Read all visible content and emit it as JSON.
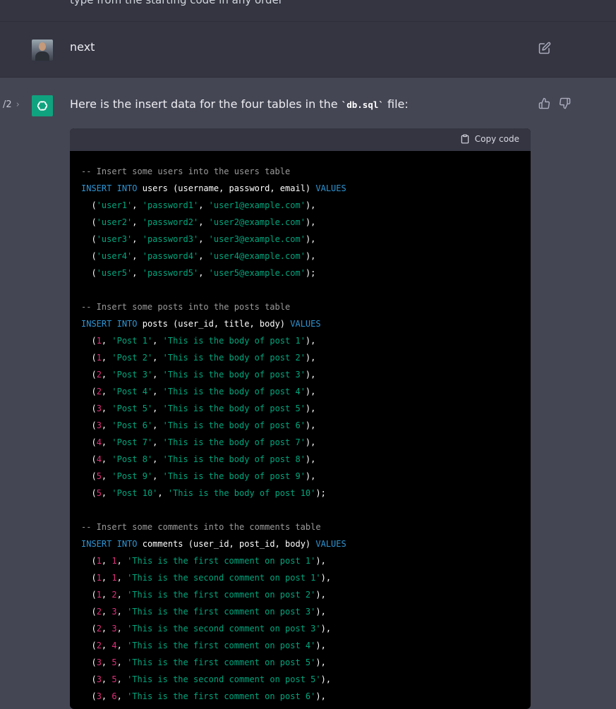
{
  "top": {
    "cut_text": "type from the starting code in any order"
  },
  "user_message": {
    "text": "next"
  },
  "assistant": {
    "pager": "/2",
    "intro_before": "Here is the insert data for the four tables in the ",
    "intro_code": "`db.sql`",
    "intro_after": " file:",
    "copy_label": "Copy code"
  },
  "code_lines": [
    [
      [
        "cm",
        "-- Insert some users into the users table"
      ]
    ],
    [
      [
        "kw",
        "INSERT"
      ],
      [
        "p",
        " "
      ],
      [
        "kw",
        "INTO"
      ],
      [
        "p",
        " users (username, password, email) "
      ],
      [
        "kw",
        "VALUES"
      ]
    ],
    [
      [
        "p",
        "  ("
      ],
      [
        "st",
        "'user1'"
      ],
      [
        "p",
        ", "
      ],
      [
        "st",
        "'password1'"
      ],
      [
        "p",
        ", "
      ],
      [
        "st",
        "'user1@example.com'"
      ],
      [
        "p",
        "),"
      ]
    ],
    [
      [
        "p",
        "  ("
      ],
      [
        "st",
        "'user2'"
      ],
      [
        "p",
        ", "
      ],
      [
        "st",
        "'password2'"
      ],
      [
        "p",
        ", "
      ],
      [
        "st",
        "'user2@example.com'"
      ],
      [
        "p",
        "),"
      ]
    ],
    [
      [
        "p",
        "  ("
      ],
      [
        "st",
        "'user3'"
      ],
      [
        "p",
        ", "
      ],
      [
        "st",
        "'password3'"
      ],
      [
        "p",
        ", "
      ],
      [
        "st",
        "'user3@example.com'"
      ],
      [
        "p",
        "),"
      ]
    ],
    [
      [
        "p",
        "  ("
      ],
      [
        "st",
        "'user4'"
      ],
      [
        "p",
        ", "
      ],
      [
        "st",
        "'password4'"
      ],
      [
        "p",
        ", "
      ],
      [
        "st",
        "'user4@example.com'"
      ],
      [
        "p",
        "),"
      ]
    ],
    [
      [
        "p",
        "  ("
      ],
      [
        "st",
        "'user5'"
      ],
      [
        "p",
        ", "
      ],
      [
        "st",
        "'password5'"
      ],
      [
        "p",
        ", "
      ],
      [
        "st",
        "'user5@example.com'"
      ],
      [
        "p",
        ");"
      ]
    ],
    [],
    [
      [
        "cm",
        "-- Insert some posts into the posts table"
      ]
    ],
    [
      [
        "kw",
        "INSERT"
      ],
      [
        "p",
        " "
      ],
      [
        "kw",
        "INTO"
      ],
      [
        "p",
        " posts (user_id, title, body) "
      ],
      [
        "kw",
        "VALUES"
      ]
    ],
    [
      [
        "p",
        "  ("
      ],
      [
        "nm",
        "1"
      ],
      [
        "p",
        ", "
      ],
      [
        "st",
        "'Post 1'"
      ],
      [
        "p",
        ", "
      ],
      [
        "st",
        "'This is the body of post 1'"
      ],
      [
        "p",
        "),"
      ]
    ],
    [
      [
        "p",
        "  ("
      ],
      [
        "nm",
        "1"
      ],
      [
        "p",
        ", "
      ],
      [
        "st",
        "'Post 2'"
      ],
      [
        "p",
        ", "
      ],
      [
        "st",
        "'This is the body of post 2'"
      ],
      [
        "p",
        "),"
      ]
    ],
    [
      [
        "p",
        "  ("
      ],
      [
        "nm",
        "2"
      ],
      [
        "p",
        ", "
      ],
      [
        "st",
        "'Post 3'"
      ],
      [
        "p",
        ", "
      ],
      [
        "st",
        "'This is the body of post 3'"
      ],
      [
        "p",
        "),"
      ]
    ],
    [
      [
        "p",
        "  ("
      ],
      [
        "nm",
        "2"
      ],
      [
        "p",
        ", "
      ],
      [
        "st",
        "'Post 4'"
      ],
      [
        "p",
        ", "
      ],
      [
        "st",
        "'This is the body of post 4'"
      ],
      [
        "p",
        "),"
      ]
    ],
    [
      [
        "p",
        "  ("
      ],
      [
        "nm",
        "3"
      ],
      [
        "p",
        ", "
      ],
      [
        "st",
        "'Post 5'"
      ],
      [
        "p",
        ", "
      ],
      [
        "st",
        "'This is the body of post 5'"
      ],
      [
        "p",
        "),"
      ]
    ],
    [
      [
        "p",
        "  ("
      ],
      [
        "nm",
        "3"
      ],
      [
        "p",
        ", "
      ],
      [
        "st",
        "'Post 6'"
      ],
      [
        "p",
        ", "
      ],
      [
        "st",
        "'This is the body of post 6'"
      ],
      [
        "p",
        "),"
      ]
    ],
    [
      [
        "p",
        "  ("
      ],
      [
        "nm",
        "4"
      ],
      [
        "p",
        ", "
      ],
      [
        "st",
        "'Post 7'"
      ],
      [
        "p",
        ", "
      ],
      [
        "st",
        "'This is the body of post 7'"
      ],
      [
        "p",
        "),"
      ]
    ],
    [
      [
        "p",
        "  ("
      ],
      [
        "nm",
        "4"
      ],
      [
        "p",
        ", "
      ],
      [
        "st",
        "'Post 8'"
      ],
      [
        "p",
        ", "
      ],
      [
        "st",
        "'This is the body of post 8'"
      ],
      [
        "p",
        "),"
      ]
    ],
    [
      [
        "p",
        "  ("
      ],
      [
        "nm",
        "5"
      ],
      [
        "p",
        ", "
      ],
      [
        "st",
        "'Post 9'"
      ],
      [
        "p",
        ", "
      ],
      [
        "st",
        "'This is the body of post 9'"
      ],
      [
        "p",
        "),"
      ]
    ],
    [
      [
        "p",
        "  ("
      ],
      [
        "nm",
        "5"
      ],
      [
        "p",
        ", "
      ],
      [
        "st",
        "'Post 10'"
      ],
      [
        "p",
        ", "
      ],
      [
        "st",
        "'This is the body of post 10'"
      ],
      [
        "p",
        ");"
      ]
    ],
    [],
    [
      [
        "cm",
        "-- Insert some comments into the comments table"
      ]
    ],
    [
      [
        "kw",
        "INSERT"
      ],
      [
        "p",
        " "
      ],
      [
        "kw",
        "INTO"
      ],
      [
        "p",
        " comments (user_id, post_id, body) "
      ],
      [
        "kw",
        "VALUES"
      ]
    ],
    [
      [
        "p",
        "  ("
      ],
      [
        "nm",
        "1"
      ],
      [
        "p",
        ", "
      ],
      [
        "nm",
        "1"
      ],
      [
        "p",
        ", "
      ],
      [
        "st",
        "'This is the first comment on post 1'"
      ],
      [
        "p",
        "),"
      ]
    ],
    [
      [
        "p",
        "  ("
      ],
      [
        "nm",
        "1"
      ],
      [
        "p",
        ", "
      ],
      [
        "nm",
        "1"
      ],
      [
        "p",
        ", "
      ],
      [
        "st",
        "'This is the second comment on post 1'"
      ],
      [
        "p",
        "),"
      ]
    ],
    [
      [
        "p",
        "  ("
      ],
      [
        "nm",
        "1"
      ],
      [
        "p",
        ", "
      ],
      [
        "nm",
        "2"
      ],
      [
        "p",
        ", "
      ],
      [
        "st",
        "'This is the first comment on post 2'"
      ],
      [
        "p",
        "),"
      ]
    ],
    [
      [
        "p",
        "  ("
      ],
      [
        "nm",
        "2"
      ],
      [
        "p",
        ", "
      ],
      [
        "nm",
        "3"
      ],
      [
        "p",
        ", "
      ],
      [
        "st",
        "'This is the first comment on post 3'"
      ],
      [
        "p",
        "),"
      ]
    ],
    [
      [
        "p",
        "  ("
      ],
      [
        "nm",
        "2"
      ],
      [
        "p",
        ", "
      ],
      [
        "nm",
        "3"
      ],
      [
        "p",
        ", "
      ],
      [
        "st",
        "'This is the second comment on post 3'"
      ],
      [
        "p",
        "),"
      ]
    ],
    [
      [
        "p",
        "  ("
      ],
      [
        "nm",
        "2"
      ],
      [
        "p",
        ", "
      ],
      [
        "nm",
        "4"
      ],
      [
        "p",
        ", "
      ],
      [
        "st",
        "'This is the first comment on post 4'"
      ],
      [
        "p",
        "),"
      ]
    ],
    [
      [
        "p",
        "  ("
      ],
      [
        "nm",
        "3"
      ],
      [
        "p",
        ", "
      ],
      [
        "nm",
        "5"
      ],
      [
        "p",
        ", "
      ],
      [
        "st",
        "'This is the first comment on post 5'"
      ],
      [
        "p",
        "),"
      ]
    ],
    [
      [
        "p",
        "  ("
      ],
      [
        "nm",
        "3"
      ],
      [
        "p",
        ", "
      ],
      [
        "nm",
        "5"
      ],
      [
        "p",
        ", "
      ],
      [
        "st",
        "'This is the second comment on post 5'"
      ],
      [
        "p",
        "),"
      ]
    ],
    [
      [
        "p",
        "  ("
      ],
      [
        "nm",
        "3"
      ],
      [
        "p",
        ", "
      ],
      [
        "nm",
        "6"
      ],
      [
        "p",
        ", "
      ],
      [
        "st",
        "'This is the first comment on post 6'"
      ],
      [
        "p",
        "),"
      ]
    ]
  ]
}
